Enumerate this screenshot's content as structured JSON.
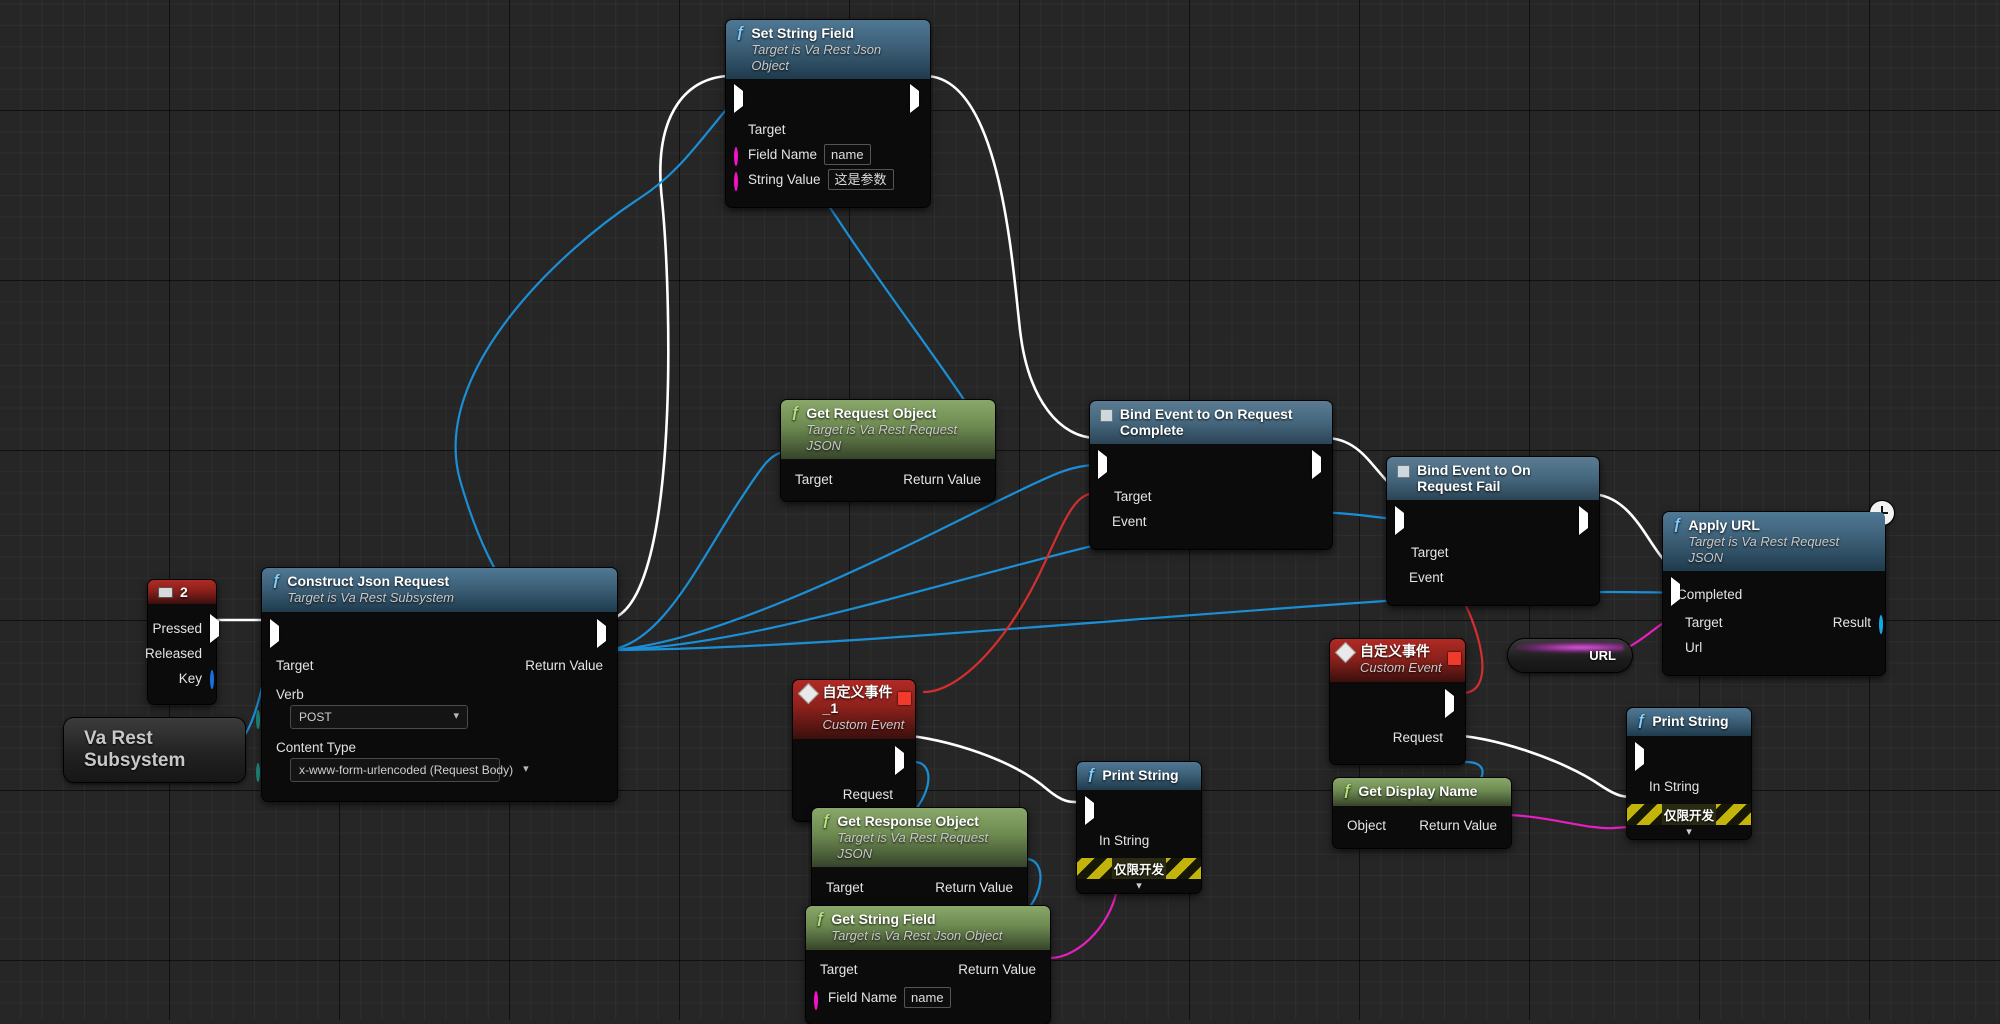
{
  "graph": {
    "title": "Unreal Engine Blueprint Event Graph",
    "colors": {
      "background": "#262626",
      "exec_wire": "#ffffff",
      "object_wire": "#1b8fd6",
      "delegate_wire": "#d32f2f",
      "string_wire": "#e81fc0",
      "function_header": "#3d6078",
      "pure_header": "#6d8a51",
      "event_header": "#8d211c"
    }
  },
  "nodes": {
    "input_key": {
      "title": "2",
      "icon": "keyboard-icon",
      "pins": [
        {
          "label": "Pressed",
          "type": "exec"
        },
        {
          "label": "Released",
          "type": "exec"
        },
        {
          "label": "Key",
          "type": "struct"
        }
      ]
    },
    "va_rest_subsystem": {
      "line1": "Va Rest",
      "line2": "Subsystem"
    },
    "construct_json_request": {
      "title": "Construct Json Request",
      "subtitle": "Target is Va Rest Subsystem",
      "inputs": [
        {
          "label": "Target",
          "type": "object"
        }
      ],
      "outputs": [
        {
          "label": "Return Value",
          "type": "object"
        }
      ],
      "fields": [
        {
          "label": "Verb",
          "value": "POST",
          "type": "enum"
        },
        {
          "label": "Content Type",
          "value": "x-www-form-urlencoded (Request Body)",
          "type": "enum"
        }
      ]
    },
    "set_string_field": {
      "title": "Set String Field",
      "subtitle": "Target is Va Rest Json Object",
      "inputs": [
        {
          "label": "Target",
          "type": "object"
        },
        {
          "label": "Field Name",
          "type": "string",
          "value": "name"
        },
        {
          "label": "String Value",
          "type": "string",
          "value": "这是参数"
        }
      ]
    },
    "get_request_object": {
      "title": "Get Request Object",
      "subtitle": "Target is Va Rest Request JSON",
      "inputs": [
        {
          "label": "Target",
          "type": "object"
        }
      ],
      "outputs": [
        {
          "label": "Return Value",
          "type": "object"
        }
      ]
    },
    "bind_event_complete": {
      "title": "Bind Event to On Request Complete",
      "inputs": [
        {
          "label": "Target",
          "type": "object"
        },
        {
          "label": "Event",
          "type": "delegate"
        }
      ]
    },
    "bind_event_fail": {
      "title": "Bind Event to On Request Fail",
      "inputs": [
        {
          "label": "Target",
          "type": "object"
        },
        {
          "label": "Event",
          "type": "delegate"
        }
      ]
    },
    "apply_url": {
      "title": "Apply URL",
      "subtitle": "Target is Va Rest Request JSON",
      "badge": "latent-clock-icon",
      "inputs": [
        {
          "label": "Target",
          "type": "object"
        },
        {
          "label": "Url",
          "type": "string"
        }
      ],
      "outputs": [
        {
          "label": "Completed",
          "type": "exec"
        },
        {
          "label": "Result",
          "type": "struct"
        }
      ]
    },
    "url_variable": {
      "name": "URL"
    },
    "custom_event_1": {
      "title": "自定义事件_1",
      "subtitle": "Custom Event",
      "outputs": [
        {
          "label": "Request",
          "type": "object"
        }
      ]
    },
    "custom_event_2": {
      "title": "自定义事件",
      "subtitle": "Custom Event",
      "outputs": [
        {
          "label": "Request",
          "type": "object"
        }
      ]
    },
    "get_response_object": {
      "title": "Get Response Object",
      "subtitle": "Target is Va Rest Request JSON",
      "inputs": [
        {
          "label": "Target",
          "type": "object"
        }
      ],
      "outputs": [
        {
          "label": "Return Value",
          "type": "object"
        }
      ]
    },
    "get_string_field": {
      "title": "Get String Field",
      "subtitle": "Target is Va Rest Json Object",
      "inputs": [
        {
          "label": "Target",
          "type": "object"
        },
        {
          "label": "Field Name",
          "type": "string",
          "value": "name"
        }
      ],
      "outputs": [
        {
          "label": "Return Value",
          "type": "string"
        }
      ]
    },
    "get_display_name": {
      "title": "Get Display Name",
      "inputs": [
        {
          "label": "Object",
          "type": "object"
        }
      ],
      "outputs": [
        {
          "label": "Return Value",
          "type": "string"
        }
      ]
    },
    "print_string_1": {
      "title": "Print String",
      "inputs": [
        {
          "label": "In String",
          "type": "string"
        }
      ],
      "dev_only_label": "仅限开发"
    },
    "print_string_2": {
      "title": "Print String",
      "inputs": [
        {
          "label": "In String",
          "type": "string"
        }
      ],
      "dev_only_label": "仅限开发"
    }
  }
}
